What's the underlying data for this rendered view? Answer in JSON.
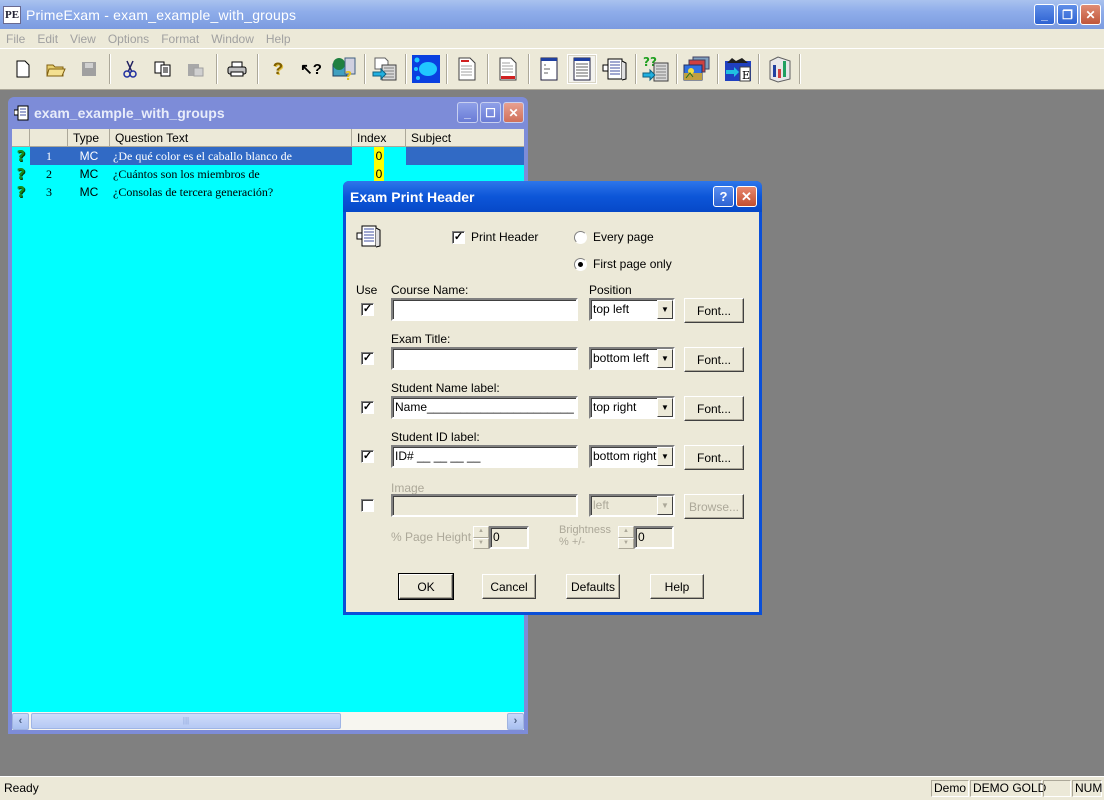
{
  "app": {
    "title": "PrimeExam - exam_example_with_groups",
    "logo": "PE",
    "window_buttons": [
      "minimize",
      "restore",
      "close"
    ]
  },
  "menu": [
    "File",
    "Edit",
    "View",
    "Options",
    "Format",
    "Window",
    "Help"
  ],
  "toolbar": {
    "tools": [
      {
        "name": "new-icon",
        "glyph": "🗋"
      },
      {
        "name": "open-icon",
        "glyph": "📂"
      },
      {
        "name": "save-icon",
        "glyph": "💾",
        "disabled": true
      },
      {
        "name": "cut-icon",
        "glyph": "✂"
      },
      {
        "name": "copy-icon",
        "glyph": "⎘"
      },
      {
        "name": "paste-icon",
        "glyph": "📋",
        "disabled": true
      },
      {
        "name": "print-icon",
        "glyph": "🖶"
      },
      {
        "name": "help-icon",
        "glyph": "?"
      },
      {
        "name": "context-help-icon",
        "glyph": "↖?"
      },
      {
        "name": "question-bank-icon",
        "glyph": "⛁"
      },
      {
        "name": "import-icon",
        "glyph": "⇥"
      },
      {
        "name": "group-icon",
        "glyph": "⬤"
      },
      {
        "name": "document-red-top-icon",
        "glyph": "🗎"
      },
      {
        "name": "document-red-bottom-icon",
        "glyph": "🗎"
      },
      {
        "name": "page-layout-icon",
        "glyph": "▤"
      },
      {
        "name": "page-lines-icon",
        "glyph": "☰"
      },
      {
        "name": "print-header-icon",
        "glyph": "▦"
      },
      {
        "name": "import-questions-icon",
        "glyph": "⇒"
      },
      {
        "name": "images-icon",
        "glyph": "🖼"
      },
      {
        "name": "export-icon",
        "glyph": "⇨"
      },
      {
        "name": "stats-icon",
        "glyph": "▥"
      }
    ]
  },
  "child_window": {
    "title": "exam_example_with_groups",
    "columns": [
      "",
      "",
      "Type",
      "Question Text",
      "Index",
      "Subject"
    ],
    "rows": [
      {
        "num": "1",
        "type": "MC",
        "text": "¿De qué color es el caballo blanco de",
        "index": "0",
        "subject": "",
        "selected": true
      },
      {
        "num": "2",
        "type": "MC",
        "text": "¿Cuántos son los miembros de",
        "index": "0",
        "subject": ""
      },
      {
        "num": "3",
        "type": "MC",
        "text": "¿Consolas de tercera generación?",
        "index": "",
        "subject": ""
      }
    ],
    "row_icon": "question-mark-icon"
  },
  "dialog": {
    "title": "Exam Print Header",
    "print_header": {
      "label": "Print Header",
      "checked": true
    },
    "page_options": [
      {
        "label": "Every page",
        "selected": false
      },
      {
        "label": "First page only",
        "selected": true
      }
    ],
    "use_label": "Use",
    "position_label": "Position",
    "fields": [
      {
        "label": "Course Name:",
        "value": "",
        "position": "top left",
        "use": true,
        "button": "Font..."
      },
      {
        "label": "Exam Title:",
        "value": "",
        "position": "bottom left",
        "use": true,
        "button": "Font..."
      },
      {
        "label": "Student Name label:",
        "value": "Name______________________",
        "position": "top right",
        "use": true,
        "button": "Font..."
      },
      {
        "label": "Student ID label:",
        "value": "ID# __ __ __ __",
        "position": "bottom right",
        "use": true,
        "button": "Font..."
      },
      {
        "label": "Image",
        "value": "",
        "position": "left",
        "use": false,
        "button": "Browse...",
        "disabled": true
      }
    ],
    "page_height": {
      "label": "% Page Height",
      "value": "0"
    },
    "brightness": {
      "label": "Brightness",
      "label2": "% +/-",
      "value": "0"
    },
    "buttons": {
      "ok": "OK",
      "cancel": "Cancel",
      "defaults": "Defaults",
      "help": "Help"
    }
  },
  "statusbar": {
    "text": "Ready",
    "panes": [
      "Demo",
      "DEMO GOLD",
      "",
      "NUM"
    ]
  }
}
